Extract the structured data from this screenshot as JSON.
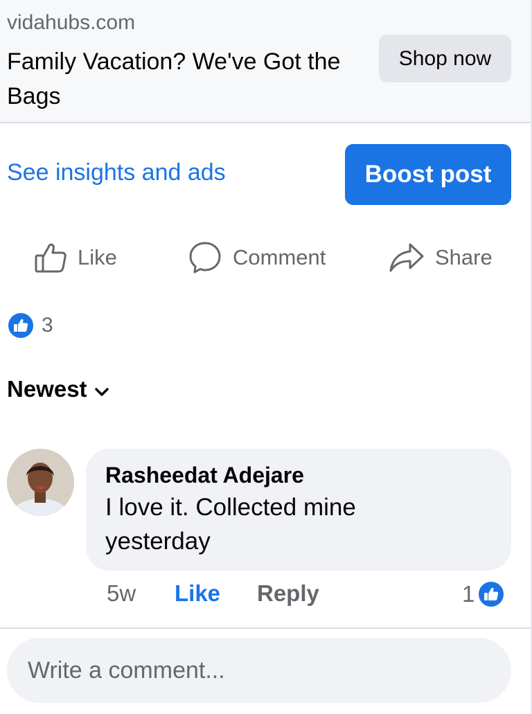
{
  "link_preview": {
    "domain": "vidahubs.com",
    "title": "Family Vacation? We've Got the Bags",
    "cta_label": "Shop now"
  },
  "post_tools": {
    "insights_label": "See insights and ads",
    "boost_label": "Boost post"
  },
  "actions": {
    "like_label": "Like",
    "comment_label": "Comment",
    "share_label": "Share"
  },
  "reactions": {
    "icon": "like-icon",
    "count": "3"
  },
  "comments_sort": {
    "label": "Newest",
    "icon": "chevron-down-icon"
  },
  "comments": [
    {
      "author": "Rasheedat Adejare",
      "text": "I love it. Collected mine yesterday",
      "time": "5w",
      "like_label": "Like",
      "reply_label": "Reply",
      "reaction_count": "1"
    }
  ],
  "composer": {
    "placeholder": "Write a comment..."
  },
  "colors": {
    "accent": "#1b74e4",
    "secondary_text": "#65676b",
    "bubble_bg": "#f0f2f5",
    "card_bg": "#f7f8fa"
  }
}
